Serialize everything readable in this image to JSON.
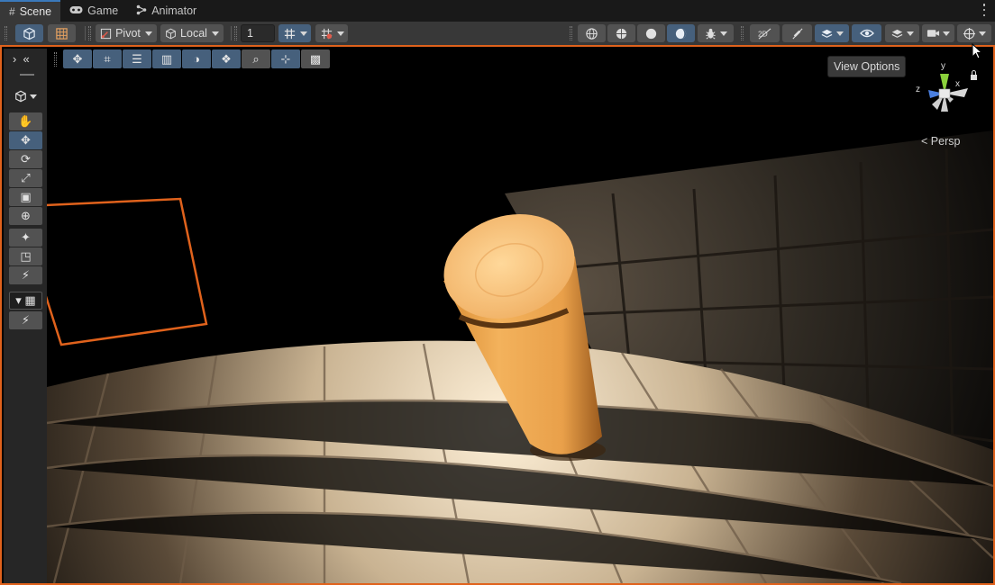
{
  "tabs": [
    {
      "label": "Scene",
      "icon": "grid-icon",
      "active": true
    },
    {
      "label": "Game",
      "icon": "gamepad-icon",
      "active": false
    },
    {
      "label": "Animator",
      "icon": "animator-icon",
      "active": false
    }
  ],
  "toolbar": {
    "pivot_label": "Pivot",
    "local_label": "Local",
    "snap_increment": "1"
  },
  "viewport": {
    "tooltip": "View Options",
    "projection_label": "Persp",
    "gizmo_axes": {
      "y": "y",
      "x": "x",
      "z": "z"
    }
  },
  "colors": {
    "selection_outline": "#e0621c",
    "active_tool": "#46607c",
    "panel_bg": "#383838"
  }
}
